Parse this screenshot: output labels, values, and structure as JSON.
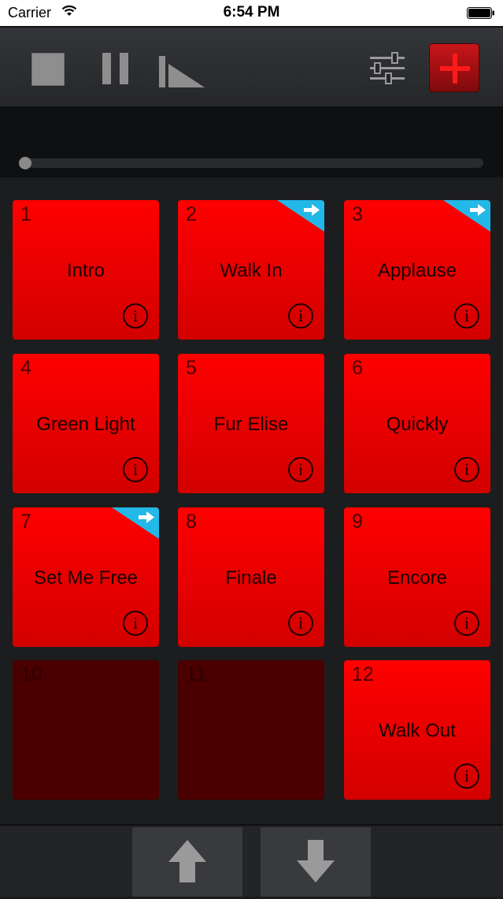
{
  "status": {
    "carrier": "Carrier",
    "time": "6:54 PM"
  },
  "toolbar": {
    "icons": [
      "stop-icon",
      "pause-icon",
      "fade-out-icon",
      "settings-sliders-icon",
      "plus-icon"
    ],
    "accent": "#c8161a"
  },
  "playback": {
    "progress": 0
  },
  "pads": [
    {
      "number": "1",
      "label": "Intro",
      "state": "active",
      "linked": false
    },
    {
      "number": "2",
      "label": "Walk In",
      "state": "active",
      "linked": true
    },
    {
      "number": "3",
      "label": "Applause",
      "state": "active",
      "linked": true
    },
    {
      "number": "4",
      "label": "Green Light",
      "state": "active",
      "linked": false
    },
    {
      "number": "5",
      "label": "Fur Elise",
      "state": "active",
      "linked": false
    },
    {
      "number": "6",
      "label": "Quickly",
      "state": "active",
      "linked": false
    },
    {
      "number": "7",
      "label": "Set Me Free",
      "state": "active",
      "linked": true
    },
    {
      "number": "8",
      "label": "Finale",
      "state": "active",
      "linked": false
    },
    {
      "number": "9",
      "label": "Encore",
      "state": "active",
      "linked": false
    },
    {
      "number": "10",
      "label": "",
      "state": "empty",
      "linked": false
    },
    {
      "number": "11",
      "label": "",
      "state": "empty",
      "linked": false
    },
    {
      "number": "12",
      "label": "Walk Out",
      "state": "active",
      "linked": false
    }
  ],
  "info_glyph": "i",
  "colors": {
    "pad_active": "#ff0000",
    "pad_empty": "#4a0000",
    "link_corner": "#22b8e8"
  }
}
